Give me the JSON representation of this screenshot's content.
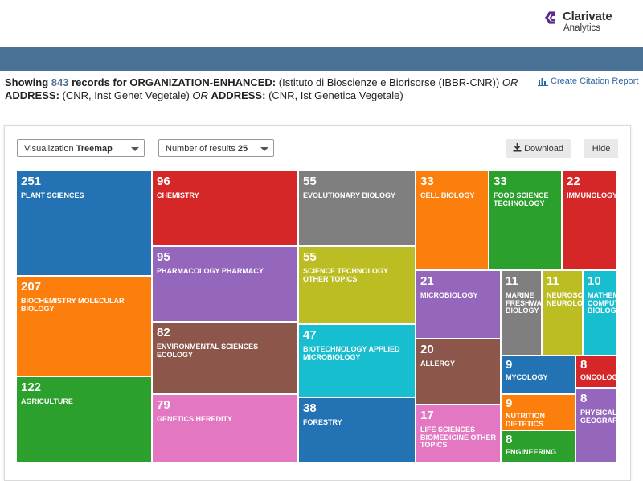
{
  "header": {
    "logo_name": "Clarivate",
    "logo_sub": "Analytics"
  },
  "query": {
    "showing": "Showing",
    "count": "843",
    "records_for": "records for",
    "field1": "ORGANIZATION-ENHANCED:",
    "value1": "(Istituto di Bioscienze e Biorisorse (IBBR-CNR))",
    "op1": "OR",
    "field2": "ADDRESS:",
    "value2": "(CNR, Inst Genet Vegetale)",
    "op2": "OR",
    "field3": "ADDRESS:",
    "value3": "(CNR, Ist Genetica Vegetale)"
  },
  "citation_report": {
    "label": "Create Citation Report"
  },
  "controls": {
    "visualization_label": "Visualization",
    "visualization_value": "Treemap",
    "results_label": "Number of results",
    "results_value": "25",
    "download_label": "Download",
    "hide_label": "Hide"
  },
  "treemap": [
    {
      "count": "251",
      "label": "PLANT SCIENCES",
      "color": "#2272b4"
    },
    {
      "count": "207",
      "label": "BIOCHEMISTRY MOLECULAR BIOLOGY",
      "color": "#fc7f0e"
    },
    {
      "count": "122",
      "label": "AGRICULTURE",
      "color": "#2ca02c"
    },
    {
      "count": "96",
      "label": "CHEMISTRY",
      "color": "#d62728"
    },
    {
      "count": "95",
      "label": "PHARMACOLOGY PHARMACY",
      "color": "#9467bd"
    },
    {
      "count": "82",
      "label": "ENVIRONMENTAL SCIENCES ECOLOGY",
      "color": "#8c564b"
    },
    {
      "count": "79",
      "label": "GENETICS HEREDITY",
      "color": "#e377c2"
    },
    {
      "count": "55",
      "label": "EVOLUTIONARY BIOLOGY",
      "color": "#7f7f7f"
    },
    {
      "count": "55",
      "label": "SCIENCE TECHNOLOGY OTHER TOPICS",
      "color": "#bcbd22"
    },
    {
      "count": "47",
      "label": "BIOTECHNOLOGY APPLIED MICROBIOLOGY",
      "color": "#17becf"
    },
    {
      "count": "38",
      "label": "FORESTRY",
      "color": "#2272b4"
    },
    {
      "count": "33",
      "label": "CELL BIOLOGY",
      "color": "#fc7f0e"
    },
    {
      "count": "33",
      "label": "FOOD SCIENCE TECHNOLOGY",
      "color": "#2ca02c"
    },
    {
      "count": "22",
      "label": "IMMUNOLOGY",
      "color": "#d62728"
    },
    {
      "count": "21",
      "label": "MICROBIOLOGY",
      "color": "#9467bd"
    },
    {
      "count": "20",
      "label": "ALLERGY",
      "color": "#8c564b"
    },
    {
      "count": "17",
      "label": "LIFE SCIENCES BIOMEDICINE OTHER TOPICS",
      "color": "#e377c2"
    },
    {
      "count": "11",
      "label": "MARINE FRESHWATER BIOLOGY",
      "color": "#7f7f7f"
    },
    {
      "count": "11",
      "label": "NEUROSCIENCES NEUROLOGY",
      "color": "#bcbd22"
    },
    {
      "count": "10",
      "label": "MATHEMATICAL COMPUTATIONAL BIOLOGY",
      "color": "#17becf"
    },
    {
      "count": "9",
      "label": "MYCOLOGY",
      "color": "#2272b4"
    },
    {
      "count": "8",
      "label": "ONCOLOGY",
      "color": "#d62728"
    },
    {
      "count": "9",
      "label": "NUTRITION DIETETICS",
      "color": "#fc7f0e"
    },
    {
      "count": "8",
      "label": "ENGINEERING",
      "color": "#2ca02c"
    },
    {
      "count": "8",
      "label": "PHYSICAL GEOGRAPHY",
      "color": "#9467bd"
    }
  ]
}
